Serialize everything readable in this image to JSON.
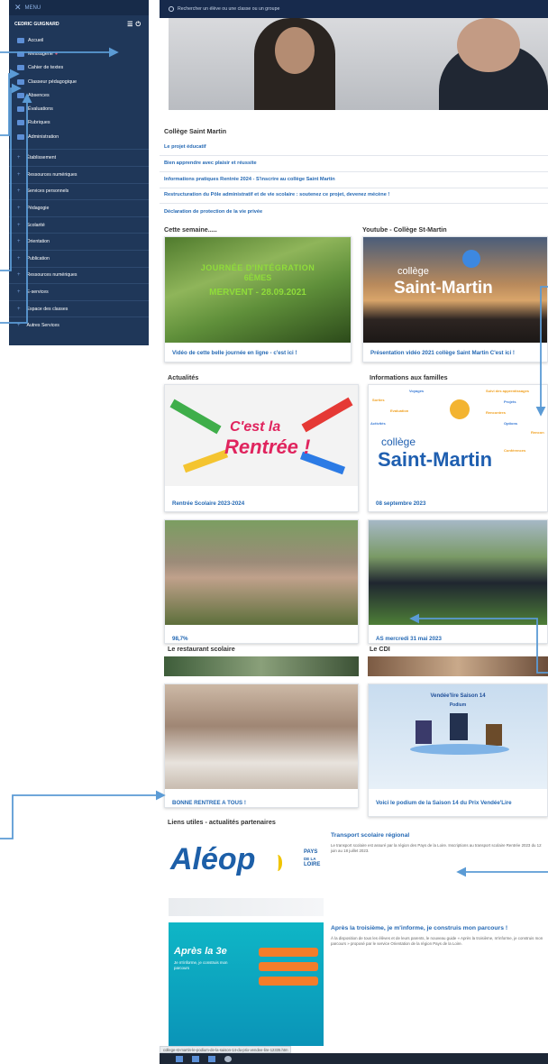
{
  "sidebar": {
    "menu_label": "MENU",
    "user_name": "CEDRIC GUIGNARD",
    "primary": [
      {
        "label": "Accueil"
      },
      {
        "label": "Messagerie",
        "badge": "●"
      },
      {
        "label": "Cahier de textes"
      },
      {
        "label": "Classeur pédagogique"
      },
      {
        "label": "Absences"
      },
      {
        "label": "Évaluations"
      },
      {
        "label": "Rubriques"
      },
      {
        "label": "Administration"
      }
    ],
    "sections": [
      {
        "label": "Établissement"
      },
      {
        "label": "Ressources numériques"
      },
      {
        "label": "Services personnels"
      },
      {
        "label": "Pédagogie"
      },
      {
        "label": "Scolarité"
      },
      {
        "label": "Orientation"
      },
      {
        "label": "Publication"
      },
      {
        "label": "Ressources numériques"
      },
      {
        "label": "E-services"
      },
      {
        "label": "Espace des classes"
      },
      {
        "label": "Autres Services"
      }
    ]
  },
  "search": {
    "placeholder": "Rechercher un élève ou une classe ou un groupe"
  },
  "school": {
    "title": "Collège Saint Martin",
    "links": [
      "Le projet éducatif",
      "Bien apprendre avec plaisir et réussite",
      "Informations pratiques Rentrée 2024 - S'inscrire au collège Saint Martin",
      "Restructuration du Pôle administratif et de vie scolaire : soutenez ce projet, devenez mécène !",
      "Déclaration de protection de la vie privée"
    ]
  },
  "cette_semaine": {
    "title": "Cette semaine.....",
    "image_text": [
      "JOURNÉE D'INTÉGRATION",
      "6ÈMES",
      "MERVENT - 28.09.2021"
    ],
    "caption": "Vidéo de cette belle journée en ligne - c'est ici !"
  },
  "youtube": {
    "title": "Youtube - Collège St-Martin",
    "logo_small": "collège",
    "logo_big": "Saint-Martin",
    "caption": "Présentation vidéo 2021 collège Saint Martin C'est ici !"
  },
  "actualites": {
    "title": "Actualités",
    "card1": {
      "img_line1": "C'est la",
      "img_line2": "Rentrée !",
      "caption": "Rentrée Scolaire 2023-2024"
    },
    "card2": {
      "caption": "98,7%"
    }
  },
  "familles": {
    "title": "Informations aux familles",
    "words": [
      "Voyages",
      "Suivi des apprentissages",
      "Sorties",
      "Projets",
      "Evaluation",
      "Rencontres",
      "Activités",
      "Options",
      "Rencon",
      "Conférences"
    ],
    "card1": {
      "caption": "08 septembre 2023"
    },
    "card2": {
      "caption": "AS mercredi 31 mai 2023"
    }
  },
  "restaurant": {
    "title": "Le restaurant scolaire",
    "caption": "BONNE RENTREE A TOUS !"
  },
  "cdi": {
    "title": "Le CDI",
    "poster_title": "Vendée'lire Saison 14",
    "poster_sub": "Podium",
    "caption": "Voici le podium de la Saison 14 du Prix Vendée'Lire"
  },
  "liens": {
    "title": "Liens utiles - actualités partenaires",
    "item1": {
      "headline": "Transport scolaire régional",
      "body": "Le transport scolaire est assuré par la région des Pays de la Loire. Inscriptions au transport scolaire Rentrée 2023 du 12 juin au 18 juillet 2023.",
      "logo": "Aléop",
      "logo_sub1": "PAYS",
      "logo_sub2": "DE LA",
      "logo_sub3": "LOIRE"
    },
    "item2": {
      "headline": "Après la troisième, je m'informe, je construis mon parcours !",
      "body": "À la disposition de tous les élèves et de leurs parents, le nouveau guide « Après la troisième, m'informe, je construis mon parcours » proposé par le service Orientation de la région Pays de la Loire.",
      "img_title": "Après la 3e",
      "img_sub": "Je m'informe, je construis mon parcours"
    }
  },
  "status_url": "college-st-martin-le-podium-de-la-saison-14-du-prix-vendee-lire-12335.htm",
  "colors": {
    "sidebar": "#1f3759",
    "link": "#2569b4",
    "arrow": "#5b9bd5"
  }
}
